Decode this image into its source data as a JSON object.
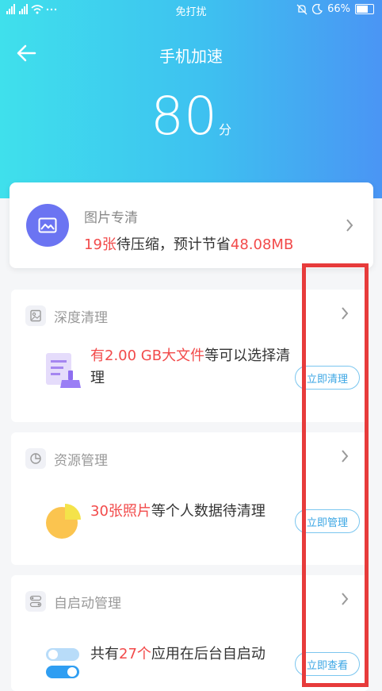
{
  "status_bar": {
    "signal": "ᵀıl ⁴ᴳıl",
    "center": "免打扰",
    "battery": "66%"
  },
  "header": {
    "title": "手机加速",
    "score": "80",
    "score_unit": "分"
  },
  "photo_card": {
    "title": "图片专清",
    "count": "19张",
    "desc_mid": "待压缩，预计节省",
    "saving": "48.08MB"
  },
  "sections": [
    {
      "title": "深度清理",
      "highlight": "有2.00 GB大文件",
      "rest": "等可以选择清理",
      "action": "立即清理",
      "icon": "image-file-icon"
    },
    {
      "title": "资源管理",
      "highlight": "30张照片",
      "rest": "等个人数据待清理",
      "action": "立即管理",
      "icon": "pie-chart-icon"
    },
    {
      "title": "自启动管理",
      "prefix": "共有",
      "highlight": "27个",
      "rest": "应用在后台自启动",
      "action": "立即查看",
      "icon": "toggle-icon"
    }
  ],
  "colors": {
    "accent_red": "#f24a4a",
    "header_start": "#3fe0ec",
    "header_end": "#4a95f4",
    "button_blue": "#3ba6e4",
    "annotation_red": "#e73b3b"
  }
}
